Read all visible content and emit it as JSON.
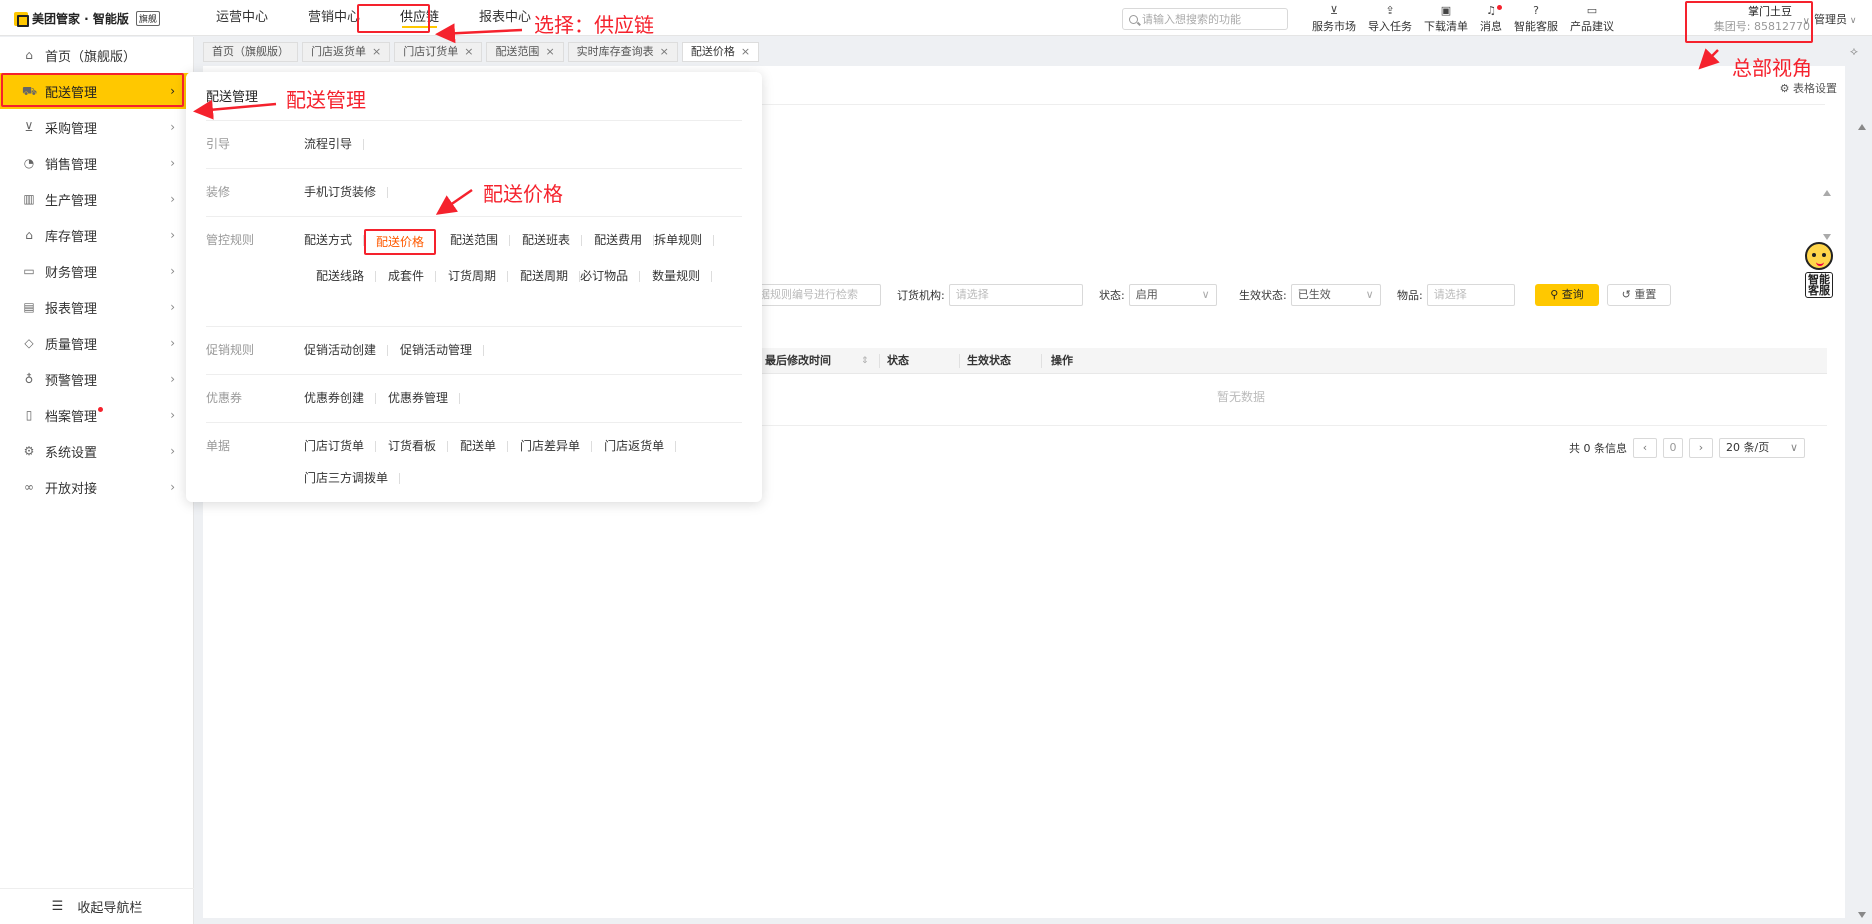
{
  "header": {
    "logo_text": "美团管家 · 智能版",
    "logo_badge": "旗舰",
    "nav": [
      "运营中心",
      "营销中心",
      "供应链",
      "报表中心"
    ],
    "search_placeholder": "请输入想搜索的功能",
    "tools": [
      {
        "label": "服务市场",
        "icon": "cart-icon"
      },
      {
        "label": "导入任务",
        "icon": "import-icon"
      },
      {
        "label": "下载清单",
        "icon": "download-icon"
      },
      {
        "label": "消息",
        "icon": "bell-icon"
      },
      {
        "label": "智能客服",
        "icon": "help-icon"
      },
      {
        "label": "产品建议",
        "icon": "feedback-icon"
      }
    ],
    "org_name": "掌门土豆",
    "org_code": "集团号: 85812770",
    "admin": "管理员"
  },
  "sidebar": {
    "items": [
      {
        "label": "首页（旗舰版）",
        "icon": "home-icon",
        "glyph": "⌂"
      },
      {
        "label": "配送管理",
        "icon": "truck-icon",
        "glyph": "⛟"
      },
      {
        "label": "采购管理",
        "icon": "cart-icon",
        "glyph": "⊻"
      },
      {
        "label": "销售管理",
        "icon": "sale-icon",
        "glyph": "◔"
      },
      {
        "label": "生产管理",
        "icon": "factory-icon",
        "glyph": "▥"
      },
      {
        "label": "库存管理",
        "icon": "warehouse-icon",
        "glyph": "⌂"
      },
      {
        "label": "财务管理",
        "icon": "wallet-icon",
        "glyph": "▭"
      },
      {
        "label": "报表管理",
        "icon": "report-icon",
        "glyph": "▤"
      },
      {
        "label": "质量管理",
        "icon": "shield-icon",
        "glyph": "◇"
      },
      {
        "label": "预警管理",
        "icon": "alarm-icon",
        "glyph": "♁"
      },
      {
        "label": "档案管理",
        "icon": "archive-icon",
        "glyph": "▯"
      },
      {
        "label": "系统设置",
        "icon": "gear-icon",
        "glyph": "⚙"
      },
      {
        "label": "开放对接",
        "icon": "link-icon",
        "glyph": "∞"
      }
    ],
    "collapse_label": "收起导航栏"
  },
  "tabs": [
    "首页（旗舰版）",
    "门店返货单",
    "门店订货单",
    "配送范围",
    "实时库存查询表",
    "配送价格"
  ],
  "flyout": {
    "title": "配送管理",
    "sections": [
      {
        "label": "引导",
        "links": [
          "流程引导"
        ]
      },
      {
        "label": "装修",
        "links": [
          "手机订货装修"
        ]
      },
      {
        "label": "管控规则",
        "links": [
          "配送方式",
          "配送价格",
          "配送范围",
          "配送班表",
          "配送费用",
          "拆单规则",
          "配送线路",
          "成套件",
          "订货周期",
          "配送周期",
          "必订物品",
          "数量规则"
        ]
      },
      {
        "label": "促销规则",
        "links": [
          "促销活动创建",
          "促销活动管理"
        ]
      },
      {
        "label": "优惠券",
        "links": [
          "优惠券创建",
          "优惠券管理"
        ]
      },
      {
        "label": "单据",
        "links": [
          "门店订货单",
          "订货看板",
          "配送单",
          "门店差异单",
          "门店返货单",
          "门店三方调拨单"
        ]
      }
    ]
  },
  "main": {
    "table_settings": "表格设置",
    "filters": {
      "keyword_placeholder": "根据规则编号进行检索",
      "org_label": "订货机构:",
      "org_placeholder": "请选择",
      "status_label": "状态:",
      "status_value": "启用",
      "effect_label": "生效状态:",
      "effect_value": "已生效",
      "item_label": "物品:",
      "item_placeholder": "请选择"
    },
    "query_button": "查询",
    "reset_button": "重置",
    "columns": [
      "最后修改时间",
      "状态",
      "生效状态",
      "操作"
    ],
    "empty_text": "暂无数据",
    "pager": {
      "total": "共 0 条信息",
      "page": "0",
      "size": "20 条/页"
    },
    "assistant_label": "智能客服"
  },
  "annotations": {
    "supply_chain": "选择：供应链",
    "delivery_mgmt": "配送管理",
    "delivery_price": "配送价格",
    "hq_view": "总部视角"
  },
  "colors": {
    "accent": "#ffc800",
    "annotation": "#f5222d",
    "highlight_link": "#ff5a00"
  }
}
